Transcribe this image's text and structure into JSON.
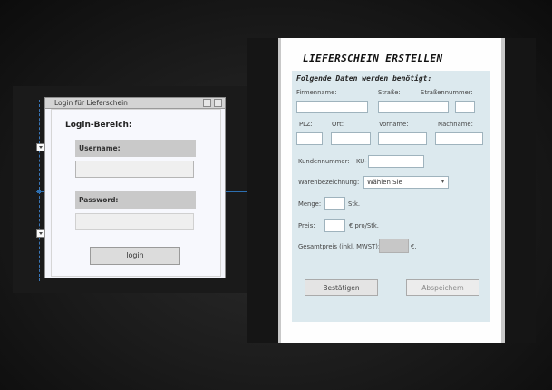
{
  "login_window": {
    "title": "Login für Lieferschein",
    "heading": "Login-Bereich:",
    "username_label": "Username:",
    "username_value": "",
    "password_label": "Password:",
    "password_value": "",
    "login_button": "login"
  },
  "lieferschein": {
    "title": "LIEFERSCHEIN ERSTELLEN",
    "subtitle": "Folgende Daten werden benötigt:",
    "labels": {
      "firmenname": "Firmenname:",
      "strasse": "Straße:",
      "strassennummer": "Straßennummer:",
      "plz": "PLZ:",
      "ort": "Ort:",
      "vorname": "Vorname:",
      "nachname": "Nachname:",
      "kundennummer": "Kundennummer:",
      "kundennummer_prefix": "KU-",
      "warenbezeichnung": "Warenbezeichnung:",
      "menge": "Menge:",
      "menge_unit": "Stk.",
      "preis": "Preis:",
      "preis_unit": "€ pro/Stk.",
      "gesamtpreis": "Gesamtpreis (inkl. MWST):",
      "gesamtpreis_unit": "€."
    },
    "values": {
      "firmenname": "",
      "strasse": "",
      "strassennummer": "",
      "plz": "",
      "ort": "",
      "vorname": "",
      "nachname": "",
      "kundennummer": "",
      "menge": "",
      "preis": "",
      "gesamtpreis": ""
    },
    "warenbezeichnung_selected": "Wählen Sie",
    "buttons": {
      "bestaetigen": "Bestätigen",
      "abspeichern": "Abspeichern"
    }
  }
}
